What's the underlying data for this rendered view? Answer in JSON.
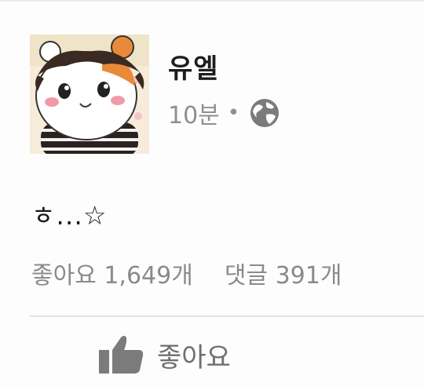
{
  "post": {
    "author": "유엘",
    "time": "10분",
    "separator": "•",
    "text": "ㅎ...☆"
  },
  "stats": {
    "likes": "좋아요 1,649개",
    "comments": "댓글 391개"
  },
  "actions": {
    "like_label": "좋아요"
  },
  "icons": {
    "privacy": "globe-icon",
    "like": "thumbs-up-icon"
  },
  "colors": {
    "meta_gray": "#8f8f8f",
    "icon_gray": "#7b7b7b",
    "text": "#1d1d1d"
  }
}
